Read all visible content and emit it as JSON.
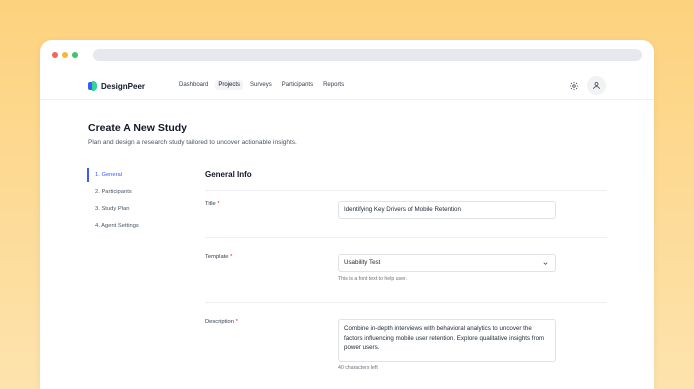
{
  "app": {
    "name": "DesignPeer",
    "brand_color": "#3b5bfd",
    "accent_green": "#34d399"
  },
  "nav": {
    "links": [
      "Dashboard",
      "Projects",
      "Surveys",
      "Participants",
      "Reports"
    ],
    "active": "Projects"
  },
  "page": {
    "title": "Create A New Study",
    "subtitle": "Plan and design a research study tailored to uncover actionable insights."
  },
  "steps": [
    "1. General",
    "2. Participants",
    "3. Study Plan",
    "4. Agent Settings"
  ],
  "active_step": "1. General",
  "form": {
    "section_title": "General Info",
    "title_label": "Title",
    "title_value": "Identifying Key Drivers of Mobile Retention",
    "template_label": "Template",
    "template_value": "Usability Test",
    "template_hint": "This is a font text to help user.",
    "description_label": "Description",
    "description_value": "Combine in-depth interviews with behavioral analytics to uncover the factors influencing mobile user retention. Explore qualitative insights from power users.",
    "description_hint": "40 characters left",
    "required_marker": "*"
  }
}
